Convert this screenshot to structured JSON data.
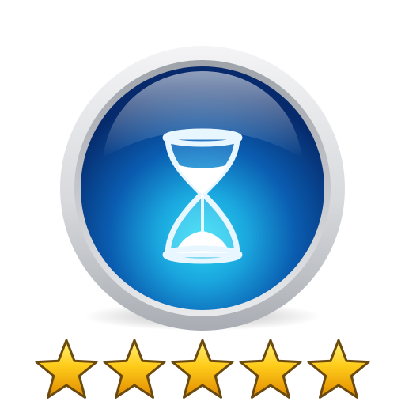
{
  "app_icon": {
    "icon": "hourglass-icon",
    "colors": {
      "bezel_light": "#f4f4f6",
      "bezel_dark": "#a9adb3",
      "orb_deep": "#062a6b",
      "orb_mid": "#0a5cb0",
      "orb_glow": "#2ad6ef",
      "glass_outline": "#e8f6ff",
      "sand": "#ffffff"
    }
  },
  "rating": {
    "value": 5,
    "max": 5,
    "icon": "star-icon",
    "colors": {
      "star_fill": "#ffcc1a",
      "star_light": "#fff27a",
      "star_dark": "#e08a00",
      "star_outline": "#6b4a10"
    }
  }
}
